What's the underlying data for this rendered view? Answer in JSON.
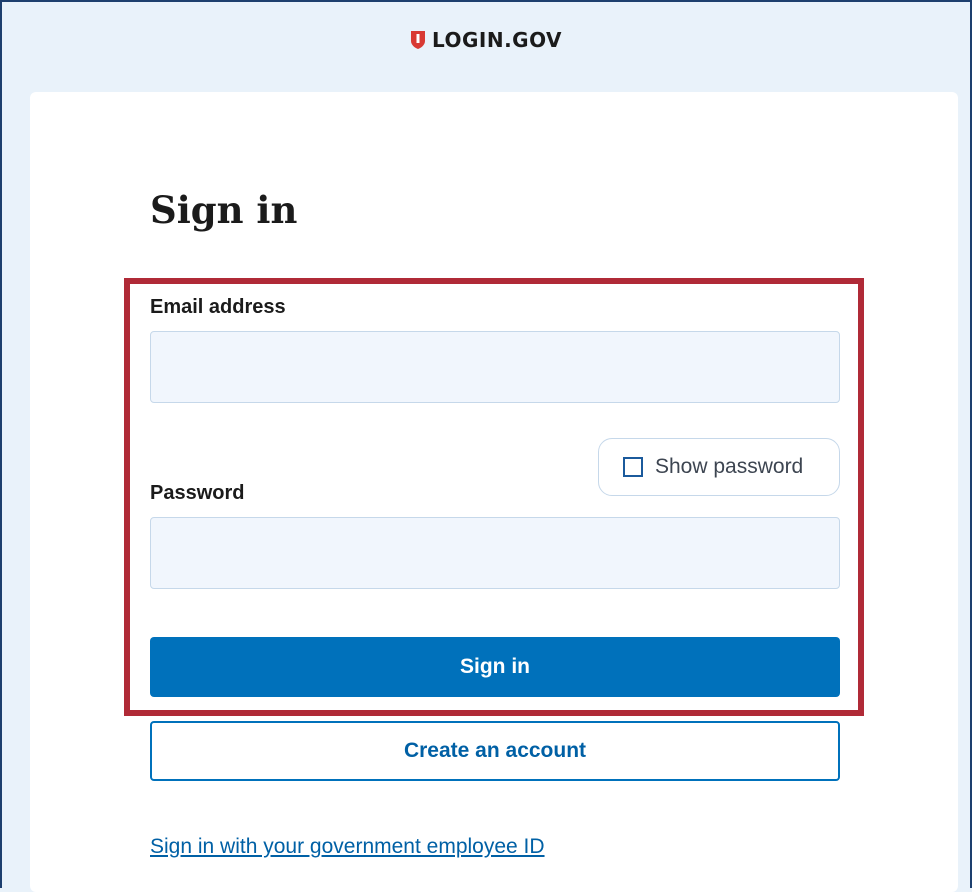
{
  "header": {
    "logo_text": "LOGIN.GOV",
    "logo_icon": "shield-icon",
    "logo_color": "#d83933"
  },
  "signin": {
    "title": "Sign in",
    "email_label": "Email address",
    "email_value": "",
    "password_label": "Password",
    "password_value": "",
    "show_password_label": "Show password",
    "show_password_checked": false,
    "submit_label": "Sign in",
    "create_account_label": "Create an account",
    "gov_id_link": "Sign in with your government employee ID"
  },
  "colors": {
    "primary": "#0071bb",
    "highlight_border": "#b02a37",
    "background": "#e9f2fa"
  }
}
